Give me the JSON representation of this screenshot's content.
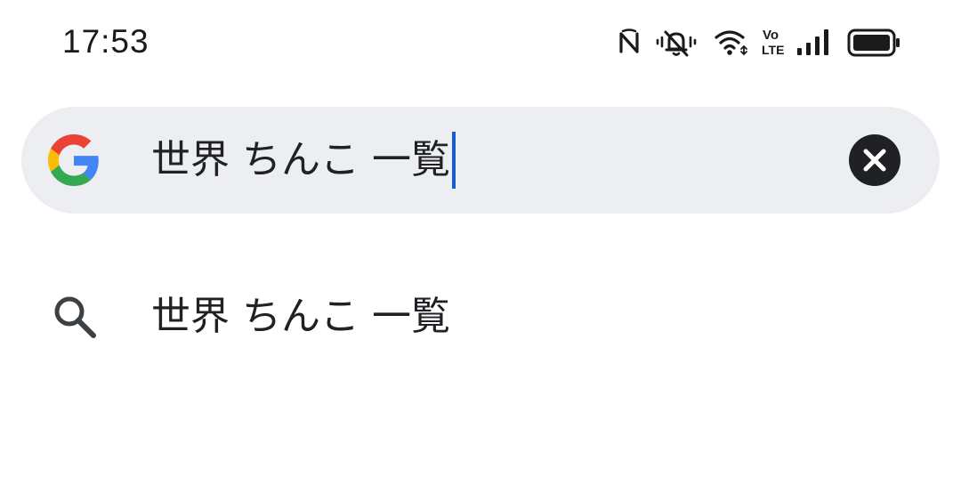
{
  "status_bar": {
    "time": "17:53",
    "icons": [
      "nfc-icon",
      "vibrate-icon",
      "wifi-icon",
      "volte-icon",
      "signal-icon",
      "battery-icon"
    ],
    "volte_top": "Vo",
    "volte_bottom": "LTE"
  },
  "search": {
    "logo": "google-g-icon",
    "query": "世界 ちんこ 一覧",
    "clear_icon": "close-icon"
  },
  "suggestions": [
    {
      "icon": "search-icon",
      "text": "世界 ちんこ 一覧"
    }
  ],
  "colors": {
    "search_bar_bg": "#eceef1",
    "caret": "#1a5dc8",
    "text": "#202124",
    "google_blue": "#4285f4",
    "google_red": "#ea4335",
    "google_yellow": "#fbbc05",
    "google_green": "#34a853"
  }
}
